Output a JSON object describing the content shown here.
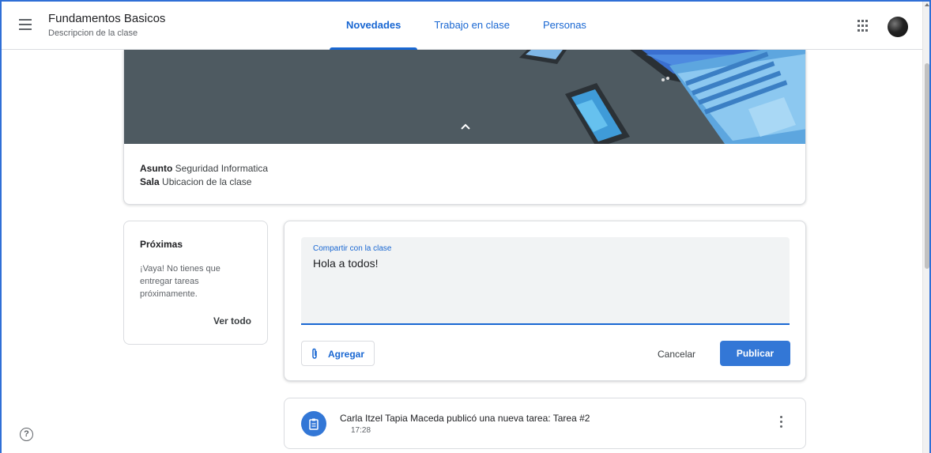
{
  "header": {
    "class_title": "Fundamentos Basicos",
    "class_subtitle": "Descripcion de la clase",
    "tabs": [
      {
        "label": "Novedades",
        "active": true
      },
      {
        "label": "Trabajo en clase",
        "active": false
      },
      {
        "label": "Personas",
        "active": false
      }
    ],
    "icons": [
      "menu-icon",
      "apps-grid-icon",
      "user-avatar"
    ]
  },
  "class_info": {
    "subject_label": "Asunto",
    "subject_value": "Seguridad Informatica",
    "room_label": "Sala",
    "room_value": "Ubicacion de la clase"
  },
  "upcoming": {
    "title": "Próximas",
    "message": "¡Vaya! No tienes que entregar tareas próximamente.",
    "view_all": "Ver todo"
  },
  "share": {
    "label": "Compartir con la clase",
    "value": "Hola a todos!",
    "add_label": "Agregar",
    "cancel_label": "Cancelar",
    "publish_label": "Publicar"
  },
  "posts": [
    {
      "title": "Carla Itzel Tapia Maceda publicó una nueva tarea: Tarea #2",
      "time": "17:28",
      "icon": "assignment-icon"
    }
  ],
  "help": {
    "glyph": "?"
  },
  "colors": {
    "accent": "#1967d2",
    "publish": "#3377d6",
    "banner": "#4f5b62"
  }
}
